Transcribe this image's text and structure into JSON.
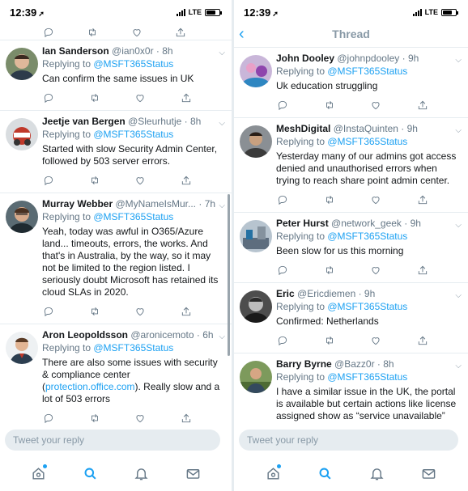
{
  "status_bar": {
    "time": "12:39",
    "location_glyph": "➚",
    "network": "LTE"
  },
  "thread": {
    "title": "Thread",
    "back_icon": "chevron-left-icon"
  },
  "reply_placeholder": "Tweet your reply",
  "colors": {
    "accent": "#1da1f2",
    "secondary_text": "#657786",
    "divider": "#e6ecf0"
  },
  "tabs": [
    {
      "name": "home",
      "icon": "home-icon",
      "has_dot": true
    },
    {
      "name": "search",
      "icon": "search-icon",
      "active": true
    },
    {
      "name": "notifications",
      "icon": "bell-icon"
    },
    {
      "name": "messages",
      "icon": "mail-icon"
    }
  ],
  "replying_prefix": "Replying to ",
  "replying_to": "@MSFT365Status",
  "left_tweets": [
    {
      "name": "Ian Sanderson",
      "handle": "@ian0x0r",
      "time": "· 8h",
      "text": "Can confirm the same issues in UK"
    },
    {
      "name": "Jeetje van Bergen",
      "handle": "@Sleurhutje",
      "time": "· 8h",
      "text": "Started with slow Security Admin Center, followed by 503 server errors."
    },
    {
      "name": "Murray Webber",
      "handle": "@MyNameIsMur...",
      "time": "· 7h",
      "text": "Yeah, today was awful in O365/Azure land... timeouts, errors, the works. And that's in Australia, by the way, so it may not be limited to the region listed. I seriously doubt Microsoft has retained its cloud SLAs in 2020."
    },
    {
      "name": "Aron Leopoldsson",
      "handle": "@aronicemoto",
      "time": "· 6h",
      "text_before": "There are also some issues with security & compliance center (",
      "link": "protection.office.com",
      "text_after": "). Really slow and a lot of 503 errors"
    }
  ],
  "right_tweets": [
    {
      "name": "John Dooley",
      "handle": "@johnpdooley",
      "time": "· 9h",
      "text": "Uk education struggling"
    },
    {
      "name": "MeshDigital",
      "handle": "@InstaQuinten",
      "time": "· 9h",
      "text": "Yesterday many of our admins got access denied and unauthorised errors when trying to reach share point admin center."
    },
    {
      "name": "Peter Hurst",
      "handle": "@network_geek",
      "time": "· 9h",
      "text": "Been slow for us this morning"
    },
    {
      "name": "Eric",
      "handle": "@Ericdiemen",
      "time": "· 9h",
      "text": "Confirmed: Netherlands"
    },
    {
      "name": "Barry Byrne",
      "handle": "@Bazz0r",
      "time": "· 8h",
      "text": "I have a similar issue in the UK, the portal is available but certain actions like license assigned show as “service unavailable”"
    }
  ]
}
